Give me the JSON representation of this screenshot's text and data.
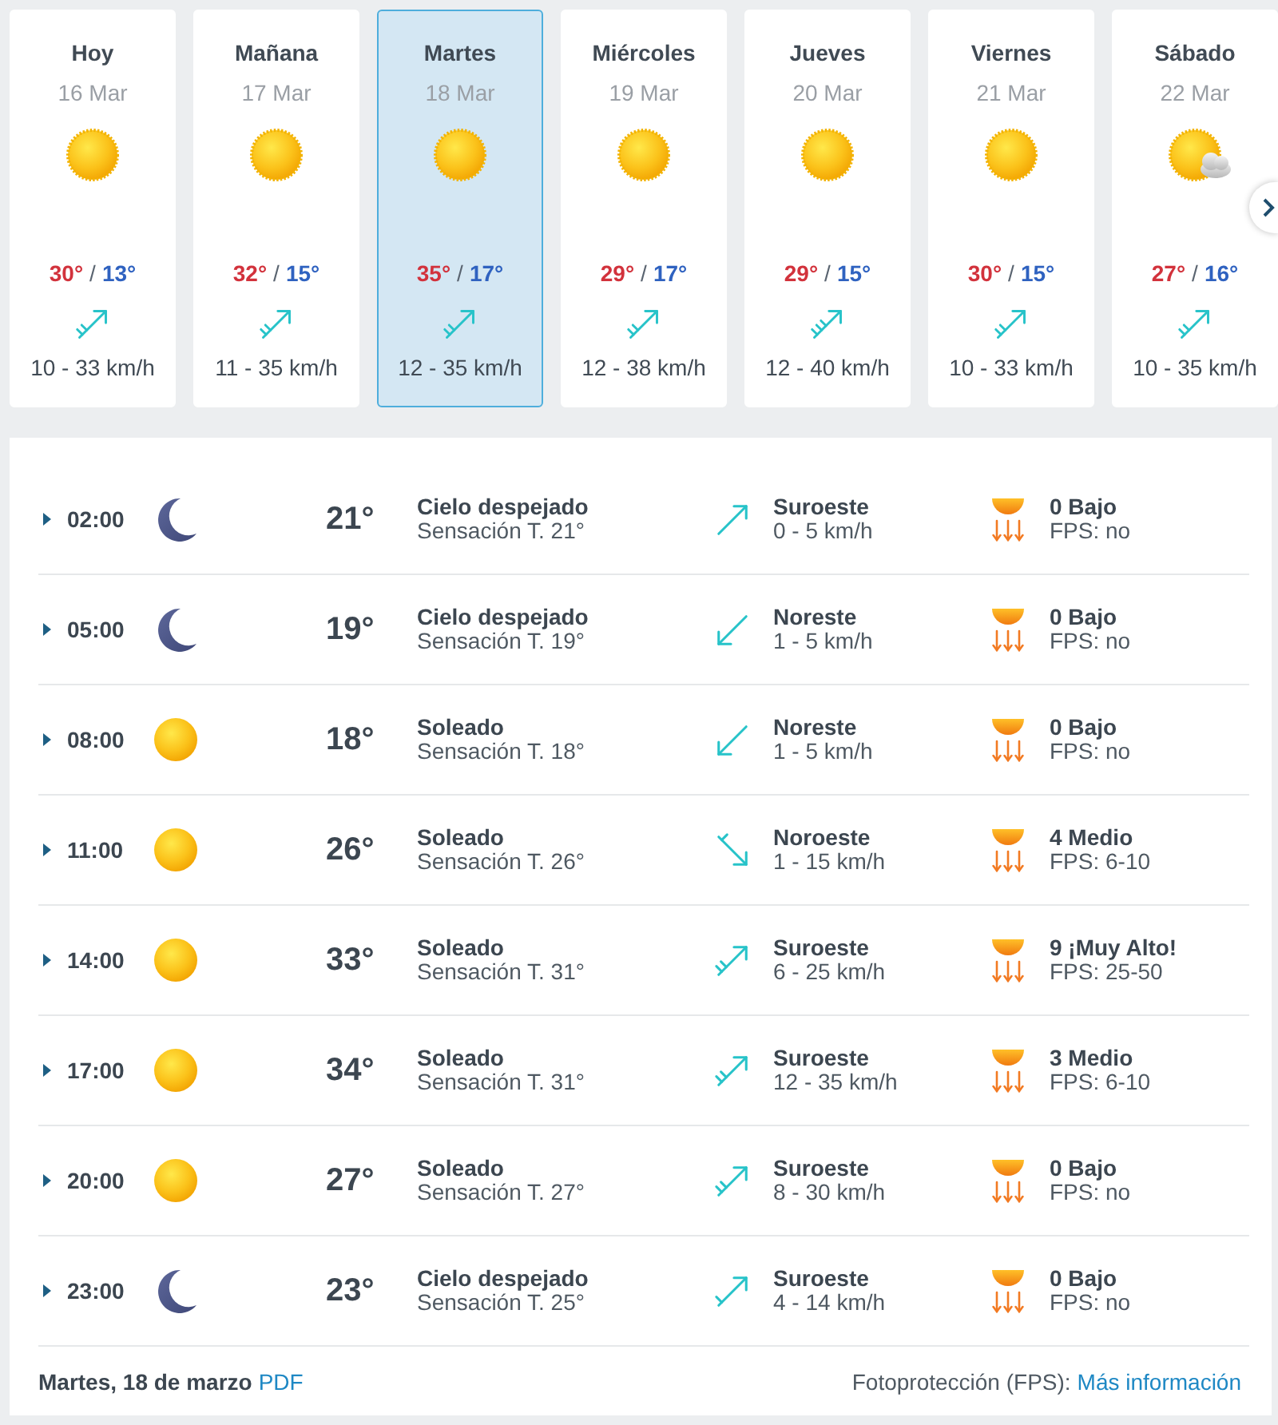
{
  "days": [
    {
      "name": "Hoy",
      "date": "16 Mar",
      "kind": "sun",
      "high": "30°",
      "separator": "/",
      "low": "13°",
      "wind": {
        "kind": "moderate",
        "heading": {
          "kind": "ne"
        }
      },
      "wind_speed": "10 - 33 km/h",
      "selected": false
    },
    {
      "name": "Mañana",
      "date": "17 Mar",
      "kind": "sun",
      "high": "32°",
      "separator": "/",
      "low": "15°",
      "wind": {
        "kind": "moderate",
        "heading": {
          "kind": "ne"
        }
      },
      "wind_speed": "11 - 35 km/h",
      "selected": false
    },
    {
      "name": "Martes",
      "date": "18 Mar",
      "kind": "sun",
      "high": "35°",
      "separator": "/",
      "low": "17°",
      "wind": {
        "kind": "moderate",
        "heading": {
          "kind": "ne"
        }
      },
      "wind_speed": "12 - 35 km/h",
      "selected": true
    },
    {
      "name": "Miércoles",
      "date": "19 Mar",
      "kind": "sun",
      "high": "29°",
      "separator": "/",
      "low": "17°",
      "wind": {
        "kind": "moderate",
        "heading": {
          "kind": "ne"
        }
      },
      "wind_speed": "12 - 38 km/h",
      "selected": false
    },
    {
      "name": "Jueves",
      "date": "20 Mar",
      "kind": "sun",
      "high": "29°",
      "separator": "/",
      "low": "15°",
      "wind": {
        "kind": "strong",
        "heading": {
          "kind": "ne"
        }
      },
      "wind_speed": "12 - 40 km/h",
      "selected": false
    },
    {
      "name": "Viernes",
      "date": "21 Mar",
      "kind": "sun",
      "high": "30°",
      "separator": "/",
      "low": "15°",
      "wind": {
        "kind": "moderate",
        "heading": {
          "kind": "ne"
        }
      },
      "wind_speed": "10 - 33 km/h",
      "selected": false
    },
    {
      "name": "Sábado",
      "date": "22 Mar",
      "kind": "suncloud",
      "high": "27°",
      "separator": "/",
      "low": "16°",
      "wind": {
        "kind": "moderate",
        "heading": {
          "kind": "ne"
        }
      },
      "wind_speed": "10 - 35 km/h",
      "selected": false
    }
  ],
  "hours": [
    {
      "time": "02:00",
      "expanded": false,
      "kind": "moon",
      "temp": "21°",
      "condition": "Cielo despejado",
      "feels_like": "Sensación T. 21°",
      "wind": {
        "kind": "calm",
        "heading": {
          "kind": "ne"
        },
        "direction": "Suroeste",
        "speed": "0 - 5 km/h"
      },
      "uv": {
        "index": "0 Bajo",
        "fps": "FPS: no"
      }
    },
    {
      "time": "05:00",
      "expanded": false,
      "kind": "moon",
      "temp": "19°",
      "condition": "Cielo despejado",
      "feels_like": "Sensación T. 19°",
      "wind": {
        "kind": "calm",
        "heading": {
          "kind": "sw"
        },
        "direction": "Noreste",
        "speed": "1 - 5 km/h"
      },
      "uv": {
        "index": "0 Bajo",
        "fps": "FPS: no"
      }
    },
    {
      "time": "08:00",
      "expanded": false,
      "kind": "sun",
      "temp": "18°",
      "condition": "Soleado",
      "feels_like": "Sensación T. 18°",
      "wind": {
        "kind": "calm",
        "heading": {
          "kind": "sw"
        },
        "direction": "Noreste",
        "speed": "1 - 5 km/h"
      },
      "uv": {
        "index": "0 Bajo",
        "fps": "FPS: no"
      }
    },
    {
      "time": "11:00",
      "expanded": false,
      "kind": "sun",
      "temp": "26°",
      "condition": "Soleado",
      "feels_like": "Sensación T. 26°",
      "wind": {
        "kind": "light",
        "heading": {
          "kind": "se"
        },
        "direction": "Noroeste",
        "speed": "1 - 15 km/h"
      },
      "uv": {
        "index": "4 Medio",
        "fps": "FPS: 6-10"
      }
    },
    {
      "time": "14:00",
      "expanded": false,
      "kind": "sun",
      "temp": "33°",
      "condition": "Soleado",
      "feels_like": "Sensación T. 31°",
      "wind": {
        "kind": "moderate",
        "heading": {
          "kind": "ne"
        },
        "direction": "Suroeste",
        "speed": "6 - 25 km/h"
      },
      "uv": {
        "index": "9 ¡Muy Alto!",
        "fps": "FPS: 25-50"
      }
    },
    {
      "time": "17:00",
      "expanded": false,
      "kind": "sun",
      "temp": "34°",
      "condition": "Soleado",
      "feels_like": "Sensación T. 31°",
      "wind": {
        "kind": "moderate",
        "heading": {
          "kind": "ne"
        },
        "direction": "Suroeste",
        "speed": "12 - 35 km/h"
      },
      "uv": {
        "index": "3 Medio",
        "fps": "FPS: 6-10"
      }
    },
    {
      "time": "20:00",
      "expanded": false,
      "kind": "sun",
      "temp": "27°",
      "condition": "Soleado",
      "feels_like": "Sensación T. 27°",
      "wind": {
        "kind": "moderate",
        "heading": {
          "kind": "ne"
        },
        "direction": "Suroeste",
        "speed": "8 - 30 km/h"
      },
      "uv": {
        "index": "0 Bajo",
        "fps": "FPS: no"
      }
    },
    {
      "time": "23:00",
      "expanded": false,
      "kind": "moon",
      "temp": "23°",
      "condition": "Cielo despejado",
      "feels_like": "Sensación T. 25°",
      "wind": {
        "kind": "light",
        "heading": {
          "kind": "ne"
        },
        "direction": "Suroeste",
        "speed": "4 - 14 km/h"
      },
      "uv": {
        "index": "0 Bajo",
        "fps": "FPS: no"
      }
    }
  ],
  "footer": {
    "date_label": "Martes, 18 de marzo",
    "pdf_link": "PDF",
    "fps_label": "Fotoprotección (FPS):",
    "info_link": "Más información"
  }
}
